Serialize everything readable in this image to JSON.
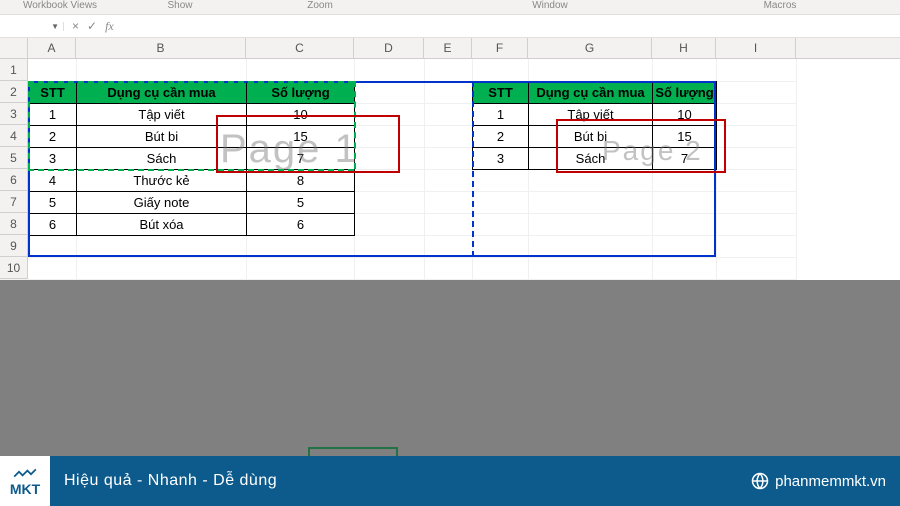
{
  "ribbon_groups": {
    "workbook_views": "Workbook Views",
    "show": "Show",
    "zoom": "Zoom",
    "window": "Window",
    "macros": "Macros"
  },
  "formula_bar": {
    "name_box": "",
    "fx_label": "fx",
    "cancel": "×",
    "confirm": "✓",
    "formula": ""
  },
  "columns": [
    "A",
    "B",
    "C",
    "D",
    "E",
    "F",
    "G",
    "H",
    "I"
  ],
  "rows": [
    "1",
    "2",
    "3",
    "4",
    "5",
    "6",
    "7",
    "8",
    "9",
    "10"
  ],
  "table1": {
    "headers": {
      "stt": "STT",
      "item": "Dụng cụ cần mua",
      "qty": "Số lượng"
    },
    "rows": [
      {
        "stt": "1",
        "item": "Tập viết",
        "qty": "10"
      },
      {
        "stt": "2",
        "item": "Bút bi",
        "qty": "15"
      },
      {
        "stt": "3",
        "item": "Sách",
        "qty": "7"
      },
      {
        "stt": "4",
        "item": "Thước kẻ",
        "qty": "8"
      },
      {
        "stt": "5",
        "item": "Giấy note",
        "qty": "5"
      },
      {
        "stt": "6",
        "item": "Bút xóa",
        "qty": "6"
      }
    ]
  },
  "table2": {
    "headers": {
      "stt": "STT",
      "item": "Dụng cụ cần mua",
      "qty": "Số lượng"
    },
    "rows": [
      {
        "stt": "1",
        "item": "Tập viết",
        "qty": "10"
      },
      {
        "stt": "2",
        "item": "Bút bi",
        "qty": "15"
      },
      {
        "stt": "3",
        "item": "Sách",
        "qty": "7"
      }
    ]
  },
  "watermark": {
    "page1": "Page 1",
    "page2": "Page 2"
  },
  "footer": {
    "logo_text": "MKT",
    "tagline": "Hiệu quả - Nhanh - Dễ dùng",
    "site": "phanmemmkt.vn"
  }
}
